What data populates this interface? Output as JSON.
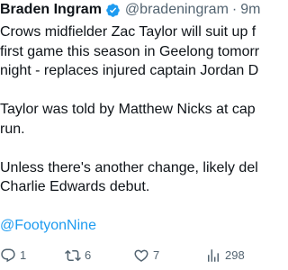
{
  "author": {
    "display_name": "Braden Ingram",
    "handle": "@bradeningram",
    "separator": "·",
    "time": "9m",
    "verified_icon": "verified-badge-icon"
  },
  "tweet": {
    "lines_p1": [
      "Crows midfielder Zac Taylor will suit up f",
      "first game this season in Geelong tomorr",
      "night - replaces injured captain Jordan D"
    ],
    "lines_p2": [
      "Taylor was told by Matthew Nicks at cap",
      "run."
    ],
    "lines_p3": [
      "Unless there's another change, likely del",
      "Charlie Edwards debut."
    ],
    "mention": "@FootyonNine"
  },
  "actions": {
    "reply": {
      "icon": "reply-icon",
      "count": "1"
    },
    "retweet": {
      "icon": "retweet-icon",
      "count": "6"
    },
    "like": {
      "icon": "like-icon",
      "count": "7"
    },
    "views": {
      "icon": "views-icon",
      "count": "298"
    }
  },
  "colors": {
    "text": "#0f1419",
    "secondary": "#536471",
    "accent": "#1d9bf0"
  }
}
